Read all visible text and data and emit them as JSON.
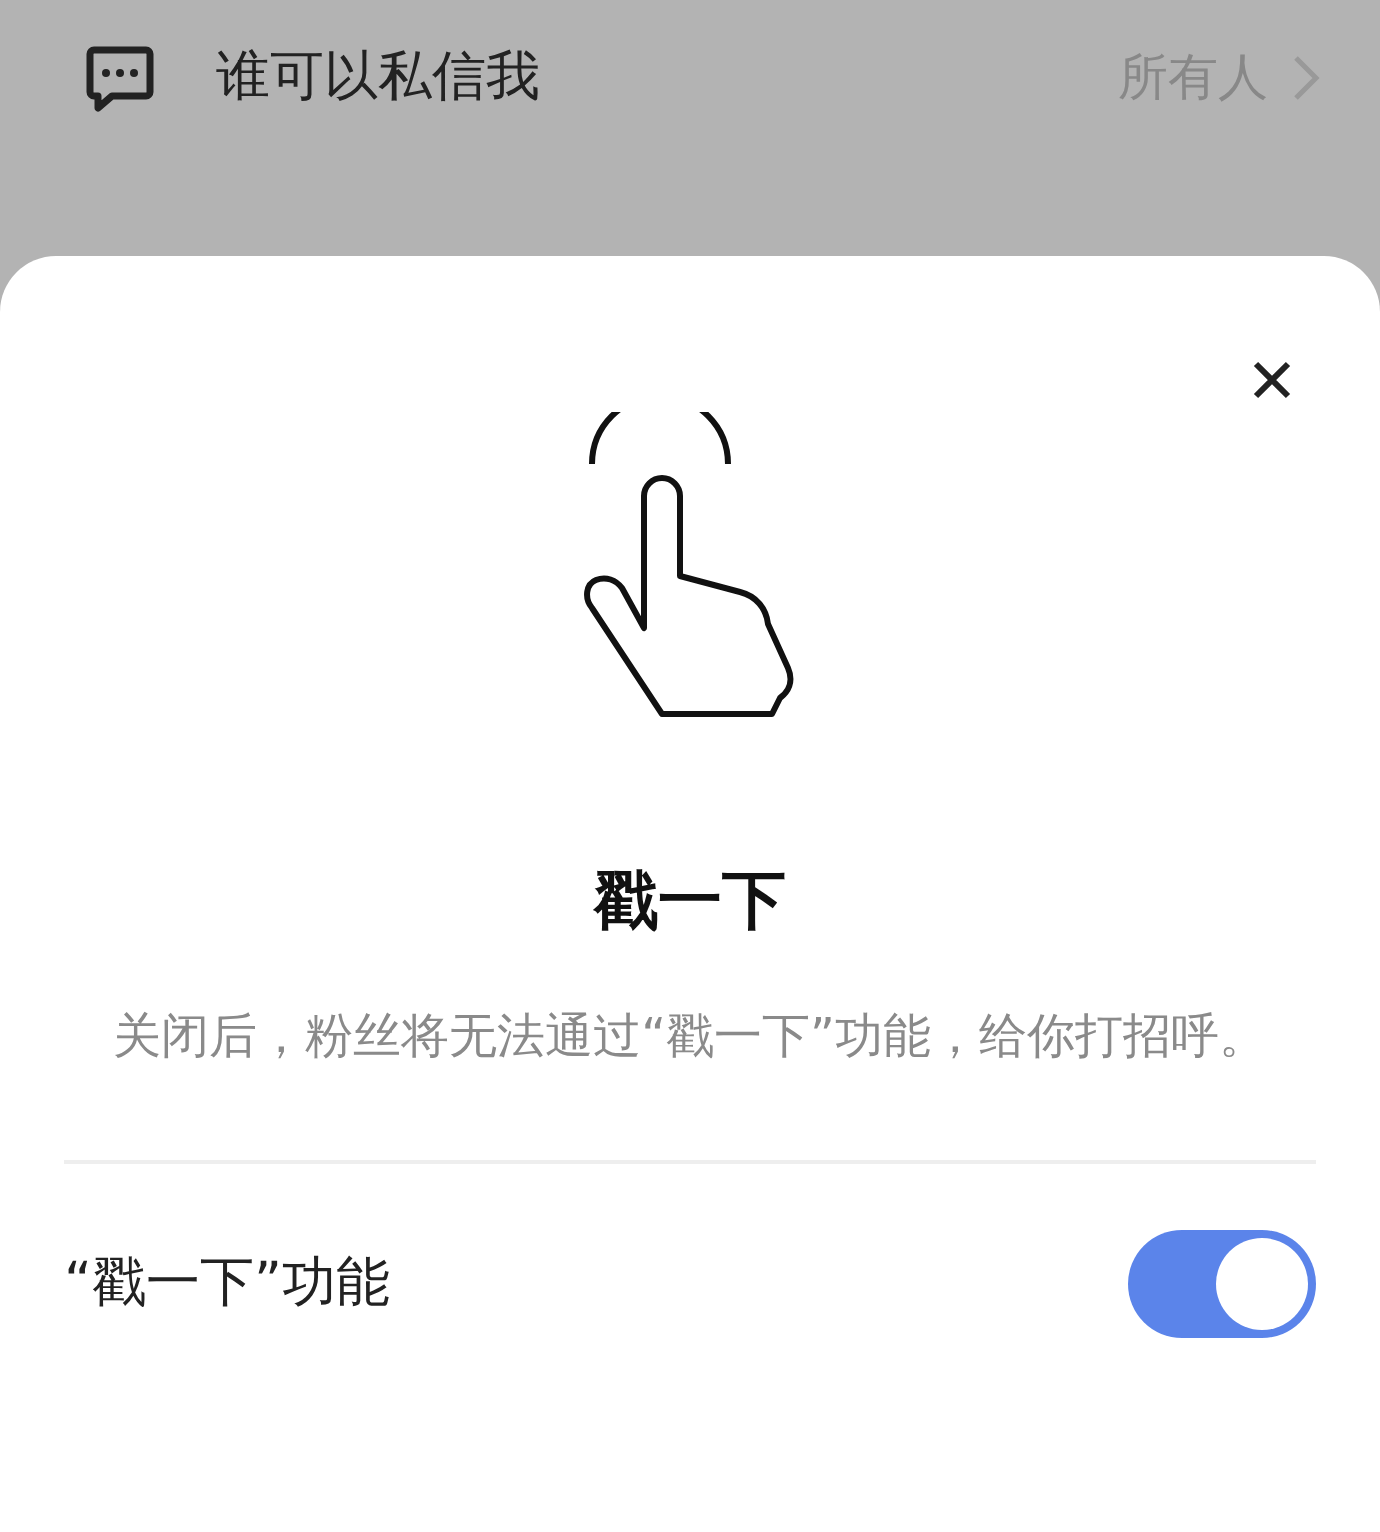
{
  "setting_row": {
    "label": "谁可以私信我",
    "value": "所有人"
  },
  "sheet": {
    "title": "戳一下",
    "description": "关闭后，粉丝将无法通过“戳一下”功能，给你打招呼。",
    "toggle": {
      "label": "“戳一下”功能",
      "on": true
    }
  }
}
